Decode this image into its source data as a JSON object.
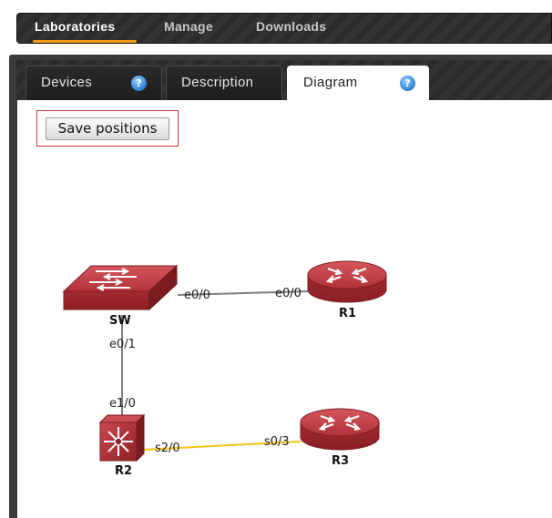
{
  "nav": {
    "items": [
      {
        "label": "Laboratories",
        "active": true
      },
      {
        "label": "Manage",
        "active": false
      },
      {
        "label": "Downloads",
        "active": false
      }
    ]
  },
  "tabs": [
    {
      "label": "Devices",
      "help": true,
      "active": false
    },
    {
      "label": "Description",
      "help": false,
      "active": false
    },
    {
      "label": "Diagram",
      "help": true,
      "active": true
    }
  ],
  "toolbar": {
    "save_label": "Save positions"
  },
  "diagram": {
    "devices": [
      {
        "name": "SW",
        "type": "switch-icon"
      },
      {
        "name": "R1",
        "type": "router-icon"
      },
      {
        "name": "R2",
        "type": "multilayer-switch-icon"
      },
      {
        "name": "R3",
        "type": "router-icon"
      }
    ],
    "links": [
      {
        "from": "SW",
        "to": "R1",
        "from_port": "e0/0",
        "to_port": "e0/0",
        "color": "#7f7f7f"
      },
      {
        "from": "SW",
        "to": "R2",
        "from_port": "e0/1",
        "to_port": "e1/0",
        "color": "#7f7f7f"
      },
      {
        "from": "R2",
        "to": "R3",
        "from_port": "s2/0",
        "to_port": "s0/3",
        "color": "#f2c418"
      }
    ]
  },
  "colors": {
    "accent": "#f29a1d",
    "device_red": "#b8353b",
    "serial_link": "#f2c418",
    "ethernet_link": "#7f7f7f",
    "highlight": "#c23c3c"
  }
}
